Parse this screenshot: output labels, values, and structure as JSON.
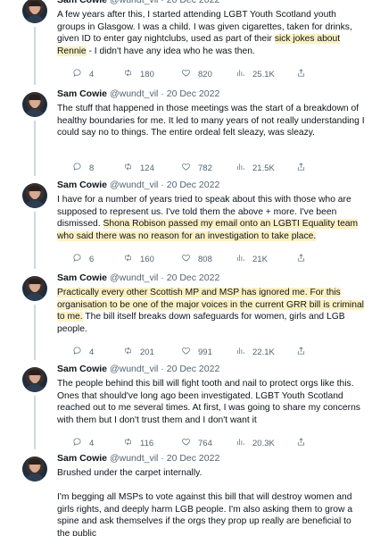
{
  "tweets": [
    {
      "name": "Sam Cowie",
      "handle": "@wundt_vil",
      "date": "20 Dec 2022",
      "text_parts": [
        {
          "t": "A few years after this, I started attending LGBT Youth Scotland youth groups in Glasgow. I was a child. I was given cigarettes, taken for drinks, given ID to enter gay nightclubs, used as part of their ",
          "hl": false
        },
        {
          "t": "sick jokes about Rennie",
          "hl": true
        },
        {
          "t": " - I didn't have any idea who he was then.",
          "hl": false
        }
      ],
      "replies": "4",
      "retweets": "180",
      "likes": "820",
      "views": "25.1K"
    },
    {
      "name": "Sam Cowie",
      "handle": "@wundt_vil",
      "date": "20 Dec 2022",
      "text_parts": [
        {
          "t": "The stuff that happened in those meetings was the start of a breakdown of healthy boundaries for me. It led to many years of not really understanding I could say no to things. The entire ordeal felt sleazy, was sleazy.",
          "hl": false
        }
      ],
      "replies": "8",
      "retweets": "124",
      "likes": "782",
      "views": "21.5K"
    },
    {
      "name": "Sam Cowie",
      "handle": "@wundt_vil",
      "date": "20 Dec 2022",
      "text_parts": [
        {
          "t": "I have for a number of years tried to speak about this with those who are supposed to represent us. I've told them the above + more. I've been dismissed. ",
          "hl": false
        },
        {
          "t": "Shona Robison passed my email onto an LGBTI Equality team who said there was no reason for an investigation to take place.",
          "hl": true
        }
      ],
      "replies": "6",
      "retweets": "160",
      "likes": "808",
      "views": "21K"
    },
    {
      "name": "Sam Cowie",
      "handle": "@wundt_vil",
      "date": "20 Dec 2022",
      "text_parts": [
        {
          "t": "Practically every other Scottish MP and MSP has ignored me. For this organisation to be one of the major voices in the current GRR bill is criminal to me.",
          "hl": true
        },
        {
          "t": " The bill itself breaks down safeguards for women, girls and LGB people.",
          "hl": false
        }
      ],
      "replies": "4",
      "retweets": "201",
      "likes": "991",
      "views": "22.1K"
    },
    {
      "name": "Sam Cowie",
      "handle": "@wundt_vil",
      "date": "20 Dec 2022",
      "text_parts": [
        {
          "t": "The people behind this bill will fight tooth and nail to protect orgs like this. Ones that should've long ago been investigated. LGBT Youth Scotland reached out to me several times. At first, I was going to share my concerns with them but I don't trust them and I don't want it",
          "hl": false
        }
      ],
      "replies": "4",
      "retweets": "116",
      "likes": "764",
      "views": "20.3K"
    },
    {
      "name": "Sam Cowie",
      "handle": "@wundt_vil",
      "date": "20 Dec 2022",
      "text_parts": [
        {
          "t": "Brushed under the carpet internally.\n\nI'm begging all MSPs to vote against this bill that will destroy women and girls rights, and deeply harm LGB people. I'm also asking them to grow a spine and ask themselves if the orgs they prop up really are beneficial to the public",
          "hl": false
        }
      ],
      "replies": "",
      "retweets": "",
      "likes": "",
      "views": ""
    }
  ]
}
